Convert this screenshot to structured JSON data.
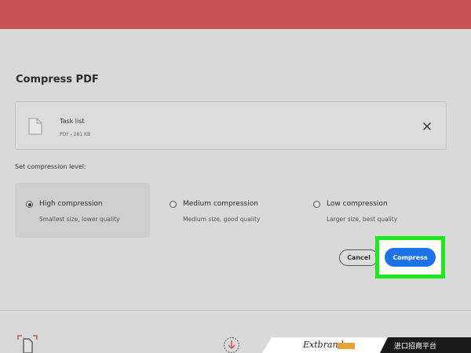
{
  "dialog": {
    "title": "Compress PDF"
  },
  "file": {
    "name": "Task list",
    "meta": "PDF - 281 KB"
  },
  "compression": {
    "label": "Set compression level:",
    "options": [
      {
        "title": "High compression",
        "subtitle": "Smallest size, lower quality",
        "selected": true
      },
      {
        "title": "Medium compression",
        "subtitle": "Medium size, good quality",
        "selected": false
      },
      {
        "title": "Low compression",
        "subtitle": "Larger size, best quality",
        "selected": false
      }
    ]
  },
  "actions": {
    "cancel_label": "Cancel",
    "compress_label": "Compress"
  },
  "watermark": {
    "brand": "Extbrand",
    "text": "进口招商平台"
  },
  "colors": {
    "top_bar": "#c85454",
    "primary": "#1d72e8",
    "highlight": "#1ee81e"
  }
}
